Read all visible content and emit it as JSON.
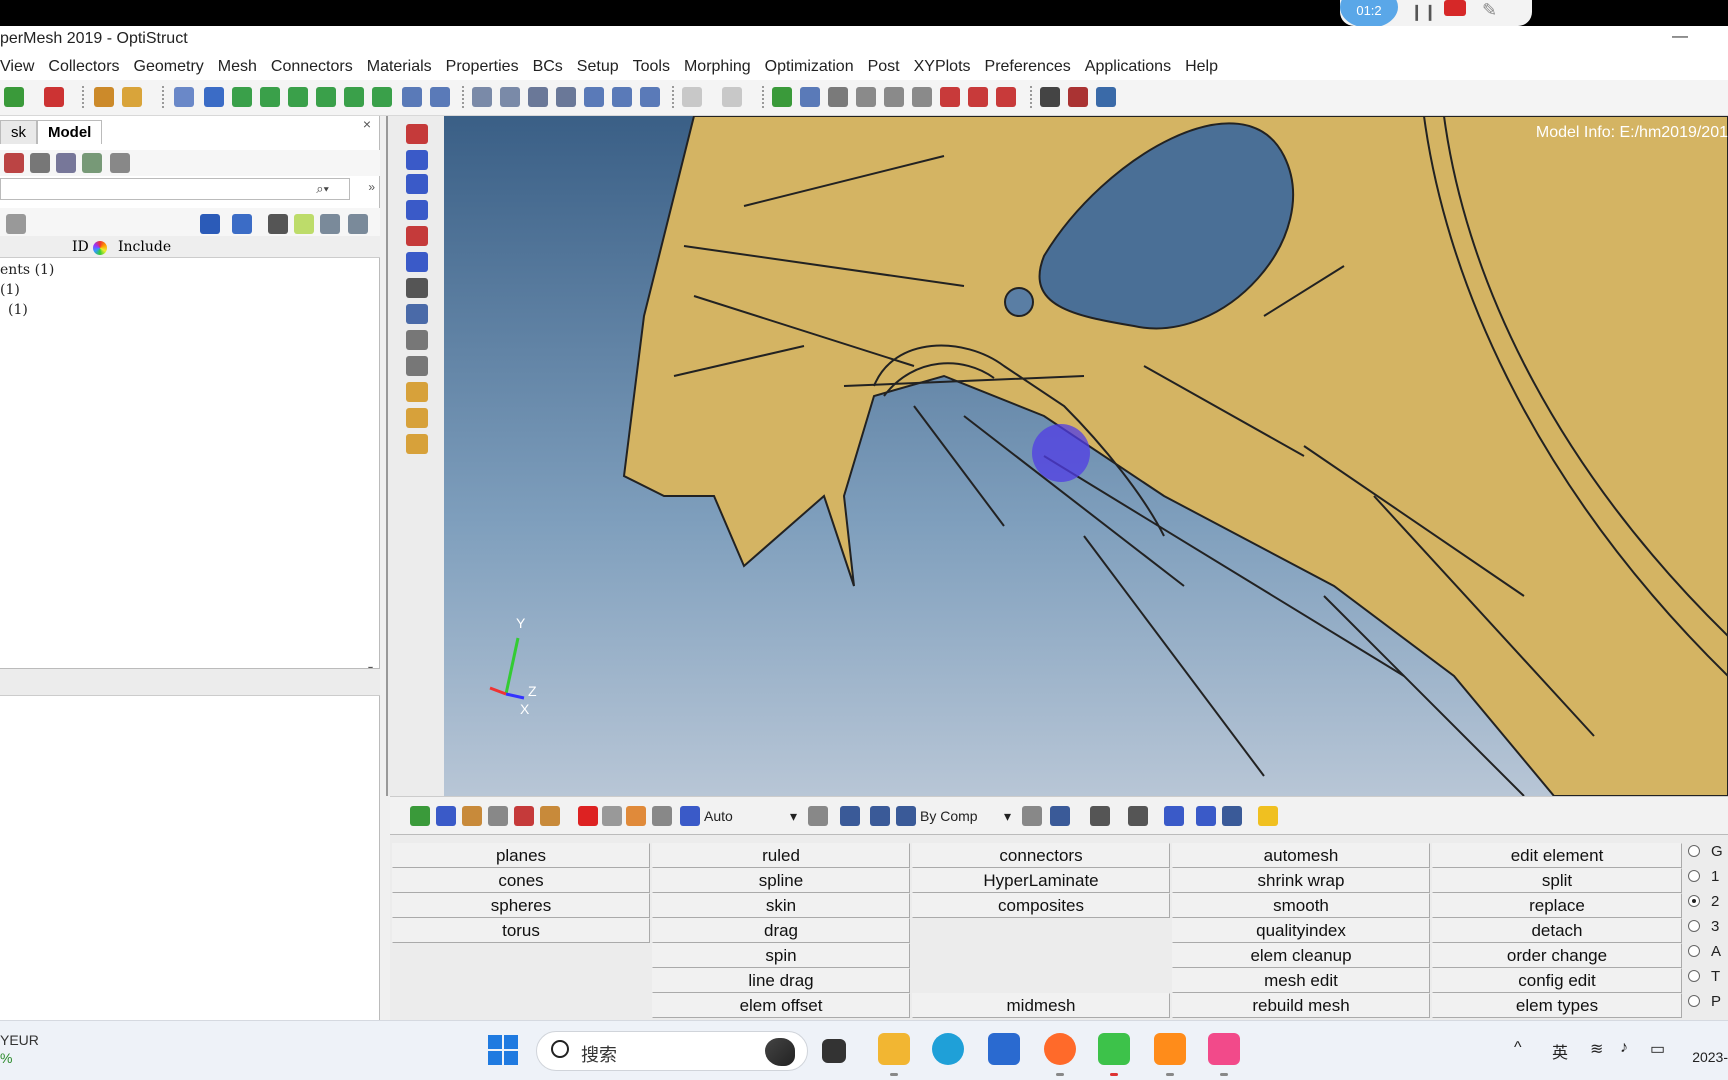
{
  "recorder": {
    "timer": "01:2",
    "pause_glyph": "❙❙",
    "pen_glyph": "✎"
  },
  "window": {
    "title": "perMesh 2019 - OptiStruct",
    "minimize_glyph": "—"
  },
  "menu": [
    "View",
    "Collectors",
    "Geometry",
    "Mesh",
    "Connectors",
    "Materials",
    "Properties",
    "BCs",
    "Setup",
    "Tools",
    "Morphing",
    "Optimization",
    "Post",
    "XYPlots",
    "Preferences",
    "Applications",
    "Help"
  ],
  "left_panel": {
    "tabs": [
      "sk",
      "Model"
    ],
    "close_glyph": "×",
    "search_glyph": "⌕▾",
    "more_glyph": "»",
    "columns": {
      "id": "ID",
      "include": "Include"
    },
    "tree": [
      "ents (1)",
      "(1)",
      "(1)"
    ],
    "splitter_glyph": "▾"
  },
  "viewport": {
    "model_info": "Model Info: E:/hm2019/201",
    "axes": {
      "y": "Y",
      "z": "Z",
      "x": "X"
    }
  },
  "lower_toolbar": {
    "display_mode": "Auto",
    "color_mode": "By Comp"
  },
  "command_panel": {
    "col1": [
      "planes",
      "cones",
      "spheres",
      "torus",
      "",
      "",
      ""
    ],
    "col2": [
      "ruled",
      "spline",
      "skin",
      "drag",
      "spin",
      "line drag",
      "elem offset"
    ],
    "col3": [
      "connectors",
      "HyperLaminate",
      "composites",
      "",
      "",
      "",
      "midmesh"
    ],
    "col4": [
      "automesh",
      "shrink wrap",
      "smooth",
      "qualityindex",
      "elem cleanup",
      "mesh edit",
      "rebuild mesh"
    ],
    "col5": [
      "edit element",
      "split",
      "replace",
      "detach",
      "order change",
      "config edit",
      "elem types"
    ],
    "radios": [
      {
        "label": "G",
        "checked": false
      },
      {
        "label": "1",
        "checked": false
      },
      {
        "label": "2",
        "checked": true
      },
      {
        "label": "3",
        "checked": false
      },
      {
        "label": "A",
        "checked": false
      },
      {
        "label": "T",
        "checked": false
      },
      {
        "label": "P",
        "checked": false
      }
    ]
  },
  "taskbar": {
    "weather_line1": "YEUR",
    "weather_line2": "%",
    "search_text": "搜索",
    "ime": "英",
    "chevron": "^",
    "clock": "2023-",
    "tray_icons": [
      "wifi-icon",
      "volume-icon",
      "battery-icon"
    ]
  },
  "colors": {
    "viewport_top": "#3a5f86",
    "model_surface": "#d4b463",
    "accent_blue": "#1f7ae0"
  }
}
